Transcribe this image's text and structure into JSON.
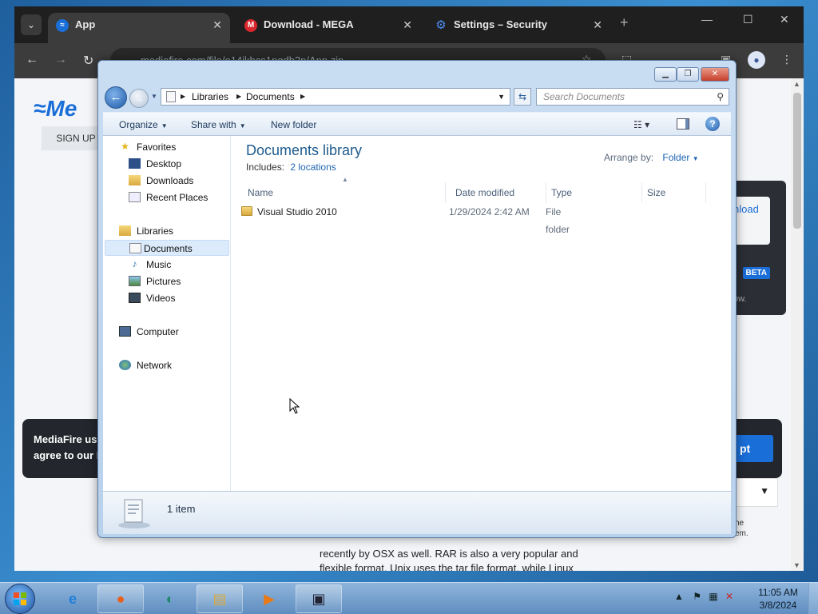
{
  "browser": {
    "tabs": [
      {
        "title": "App",
        "favicon": "mediafire-icon",
        "active": true
      },
      {
        "title": "Download - MEGA",
        "favicon": "mega-icon",
        "active": false
      },
      {
        "title": "Settings – Security",
        "favicon": "gear-icon",
        "active": false
      }
    ],
    "url": "mediafire.com/file/o14ikhcs1pgdb2p/App.zip",
    "page": {
      "logo_text": "Me",
      "signup": "SIGN UP",
      "download_btn": "nload",
      "beta": "BETA",
      "dl_note": "ow.",
      "cookie_line1": "MediaFire use",
      "cookie_line2": "agree to our F",
      "cookie_btn": "pt",
      "side_note_1": "he",
      "side_note_2": "em.",
      "article_1": "recently by OSX as well. RAR is also a very popular and",
      "article_2": "flexible format. Unix uses the tar file format, while Linux"
    }
  },
  "explorer": {
    "breadcrumb": [
      "Libraries",
      "Documents"
    ],
    "search_placeholder": "Search Documents",
    "commands": {
      "organize": "Organize",
      "share": "Share with",
      "new_folder": "New folder"
    },
    "nav": {
      "favorites": "Favorites",
      "desktop": "Desktop",
      "downloads": "Downloads",
      "recent": "Recent Places",
      "libraries": "Libraries",
      "documents": "Documents",
      "music": "Music",
      "pictures": "Pictures",
      "videos": "Videos",
      "computer": "Computer",
      "network": "Network"
    },
    "library": {
      "title": "Documents library",
      "includes_label": "Includes:",
      "includes_link": "2 locations",
      "arrange_label": "Arrange by:",
      "arrange_value": "Folder"
    },
    "columns": {
      "name": "Name",
      "date": "Date modified",
      "type": "Type",
      "size": "Size"
    },
    "files": [
      {
        "name": "Visual Studio 2010",
        "date": "1/29/2024 2:42 AM",
        "type": "File folder",
        "size": ""
      }
    ],
    "status": "1 item"
  },
  "taskbar": {
    "time": "11:05 AM",
    "date": "3/8/2024"
  }
}
